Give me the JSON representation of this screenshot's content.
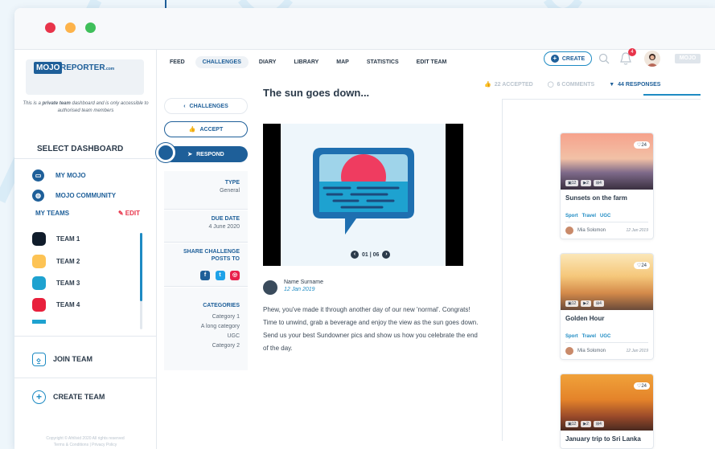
{
  "sidebar": {
    "logo_box": "MOJO",
    "logo_rest": "REPORTER",
    "logo_suffix": ".com",
    "notice_pre": "This is a ",
    "notice_bold": "private team",
    "notice_post": " dashboard and is only accessible to authorised team members",
    "select_dashboard": "SELECT DASHBOARD",
    "dashboards": [
      {
        "label": "MY MOJO",
        "icon": "chat-icon"
      },
      {
        "label": "MOJO COMMUNITY",
        "icon": "globe-icon"
      }
    ],
    "my_teams": "MY TEAMS",
    "edit": "EDIT",
    "teams": [
      {
        "label": "TEAM 1",
        "color": "#101c2b"
      },
      {
        "label": "TEAM 2",
        "color": "#fdc354"
      },
      {
        "label": "TEAM 3",
        "color": "#1ea2d0"
      },
      {
        "label": "TEAM 4",
        "color": "#e8203c"
      }
    ],
    "join_team": "JOIN TEAM",
    "create_team": "CREATE TEAM",
    "copyright_1": "Copyright © Afrilivid 2020 All rights reserved",
    "copyright_2": "Terms & Conditions | Privacy Policy"
  },
  "nav": {
    "items": [
      "FEED",
      "CHALLENGES",
      "DIARY",
      "LIBRARY",
      "MAP",
      "STATISTICS",
      "EDIT TEAM"
    ],
    "active": "CHALLENGES",
    "create": "CREATE",
    "notifications": "4",
    "mini_logo": "MOJO"
  },
  "challenge": {
    "back": "CHALLENGES",
    "accept": "ACCEPT",
    "respond": "RESPOND",
    "type_label": "TYPE",
    "type_value": "General",
    "due_label": "DUE DATE",
    "due_value": "4 June 2020",
    "share_label_1": "SHARE CHALLENGE",
    "share_label_2": "POSTS TO",
    "categories_label": "CATEGORIES",
    "categories": [
      "Category 1",
      "A long category",
      "UGC",
      "Category 2"
    ],
    "title": "The sun goes down...",
    "pager": "01 | 06",
    "author": "Name Surname",
    "date": "12 Jan 2019",
    "description": "Phew, you've made it through another day of our new 'normal'. Congrats! Time to unwind, grab a beverage and enjoy the view as the sun goes down. Send us your best Sundowner pics and show us how you celebrate the end of the day."
  },
  "stats": {
    "accepted": "22 ACCEPTED",
    "comments": "6 COMMENTS",
    "responses": "44 RESPONSES"
  },
  "responses": [
    {
      "title": "Sunsets on the farm",
      "likes": "24",
      "photos": "12",
      "videos": "2",
      "other": "4",
      "tags": [
        "Sport",
        "Travel",
        "UGC"
      ],
      "author": "Mia Solomon",
      "date": "12 Jan 2019"
    },
    {
      "title": "Golden Hour",
      "likes": "24",
      "photos": "12",
      "videos": "2",
      "other": "4",
      "tags": [
        "Sport",
        "Travel",
        "UGC"
      ],
      "author": "Mia Solomon",
      "date": "12 Jan 2019"
    },
    {
      "title": "January trip to Sri Lanka",
      "likes": "24",
      "photos": "12",
      "videos": "2",
      "other": "4",
      "tags": [],
      "author": "",
      "date": ""
    }
  ]
}
